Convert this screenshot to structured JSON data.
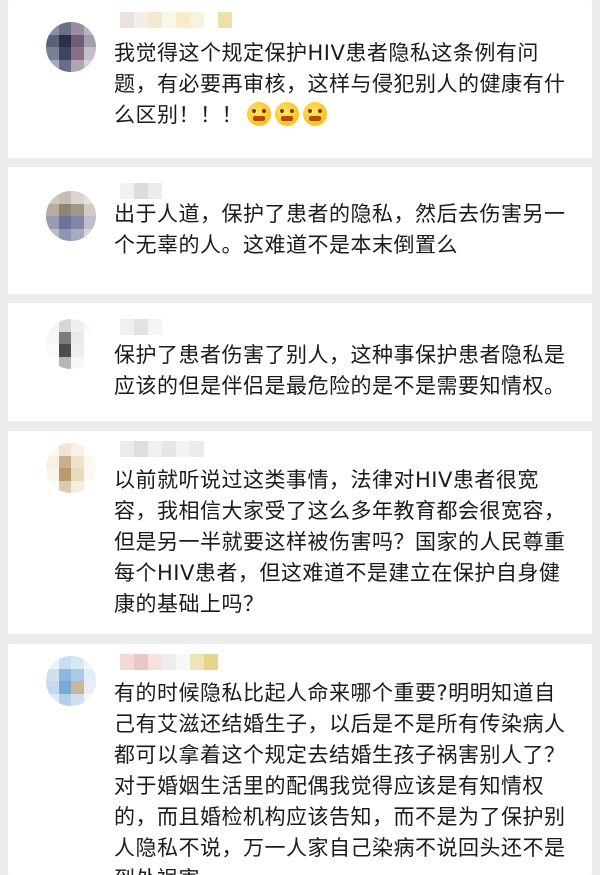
{
  "comments": [
    {
      "text": "我觉得这个规定保护HIV患者隐私这条例有问题，有必要再审核，这样与侵犯别人的健康有什么区别！！！",
      "emoji": [
        "angry-emoji",
        "angry-emoji",
        "angry-emoji"
      ]
    },
    {
      "text": "出于人道，保护了患者的隐私，然后去伤害另一个无辜的人。这难道不是本末倒置么"
    },
    {
      "text": "保护了患者伤害了别人，这种事保护患者隐私是应该的但是伴侣是最危险的是不是需要知情权。"
    },
    {
      "text": "以前就听说过这类事情，法律对HIV患者很宽容，我相信大家受了这么多年教育都会很宽容，但是另一半就要这样被伤害吗？国家的人民尊重每个HIV患者，但这难道不是建立在保护自身健康的基础上吗？"
    },
    {
      "text": "有的时候隐私比起人命来哪个重要?明明知道自己有艾滋还结婚生子，以后是不是所有传染病人都可以拿着这个规定去结婚生孩子祸害别人了？对于婚姻生活里的配偶我觉得应该是有知情权的，而且婚检机构应该告知，而不是为了保护别人隐私不说，万一人家自己染病不说回头还不是到处祸害"
    }
  ],
  "colors": {
    "background": "#ececec",
    "card": "#ffffff",
    "text": "#1b1b1b",
    "emoji": "#f6b500"
  }
}
